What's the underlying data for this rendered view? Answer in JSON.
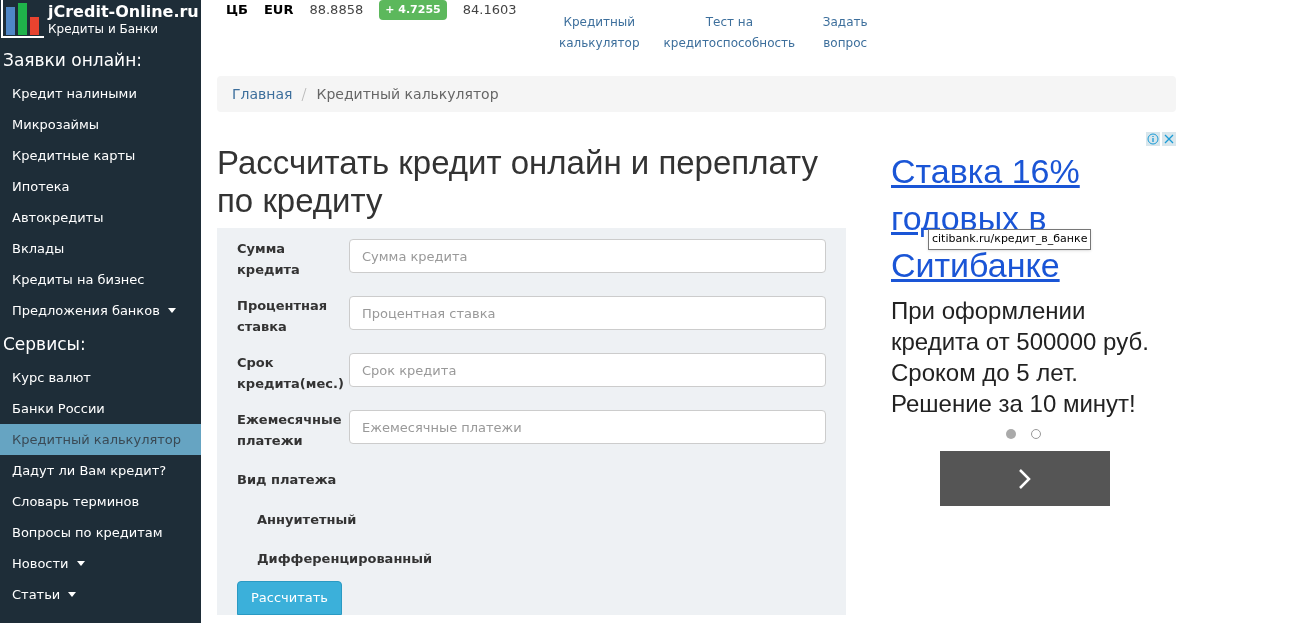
{
  "logo": {
    "title": "jCredit-Online.ru",
    "subtitle": "Кредиты и Банки"
  },
  "rates": {
    "source": "ЦБ",
    "currency": "EUR",
    "value": "88.8858",
    "change": "+ 4.7255",
    "value_2": "84.1603"
  },
  "top_links": [
    {
      "label": "Кредитный калькулятор"
    },
    {
      "label": "Тест на кредитоспособность"
    },
    {
      "label": "Задать вопрос"
    }
  ],
  "sidebar": {
    "sections": [
      {
        "title": "Заявки онлайн:",
        "items": [
          {
            "label": "Кредит налиными",
            "selected": false,
            "dropdown": false
          },
          {
            "label": "Микрозаймы",
            "selected": false,
            "dropdown": false
          },
          {
            "label": "Кредитные карты",
            "selected": false,
            "dropdown": false
          },
          {
            "label": "Ипотека",
            "selected": false,
            "dropdown": false
          },
          {
            "label": "Автокредиты",
            "selected": false,
            "dropdown": false
          },
          {
            "label": "Вклады",
            "selected": false,
            "dropdown": false
          },
          {
            "label": "Кредиты на бизнес",
            "selected": false,
            "dropdown": false
          },
          {
            "label": "Предложения банков",
            "selected": false,
            "dropdown": true
          }
        ]
      },
      {
        "title": "Сервисы:",
        "items": [
          {
            "label": "Курс валют",
            "selected": false,
            "dropdown": false
          },
          {
            "label": "Банки России",
            "selected": false,
            "dropdown": false
          },
          {
            "label": "Кредитный калькулятор",
            "selected": true,
            "dropdown": false
          },
          {
            "label": "Дадут ли Вам кредит?",
            "selected": false,
            "dropdown": false
          },
          {
            "label": "Словарь терминов",
            "selected": false,
            "dropdown": false
          },
          {
            "label": "Вопросы по кредитам",
            "selected": false,
            "dropdown": false
          },
          {
            "label": "Новости",
            "selected": false,
            "dropdown": true
          },
          {
            "label": "Статьи",
            "selected": false,
            "dropdown": true
          }
        ]
      }
    ]
  },
  "breadcrumb": [
    {
      "label": "Главная"
    },
    {
      "label": "Кредитный калькулятор"
    }
  ],
  "heading": "Рассчитать кредит онлайн и переплату по кредиту",
  "form": {
    "fields": [
      {
        "label": "Сумма кредита",
        "placeholder": "Сумма кредита"
      },
      {
        "label": "Процентная ставка",
        "placeholder": "Процентная ставка"
      },
      {
        "label": "Срок кредита(мес.)",
        "placeholder": "Срок кредита"
      },
      {
        "label": "Ежемесячные платежи",
        "placeholder": "Ежемесячные платежи"
      }
    ],
    "payment_type": {
      "label": "Вид платежа",
      "options": [
        {
          "label": "Аннуитетный"
        },
        {
          "label": "Дифференцированный"
        }
      ]
    },
    "submit": "Рассчитать"
  },
  "ad": {
    "headline": [
      "Ставка 16%",
      "годовых в",
      "Ситибанке"
    ],
    "tooltip": "citibank.ru/кредит_в_банке",
    "body": "При оформлении кредита от 500000 руб. Сроком до 5 лет. Решение за 10 минут!",
    "dots": [
      {
        "selected": true
      },
      {
        "selected": false
      }
    ]
  }
}
